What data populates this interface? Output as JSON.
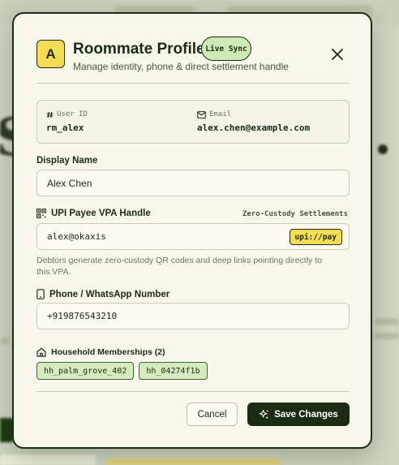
{
  "background": {
    "large_letter": "S"
  },
  "header": {
    "avatar_letter": "A",
    "title": "Roommate Profile",
    "badge": "Live Sync",
    "subtitle": "Manage identity, phone & direct settlement handle",
    "close_icon": "close-icon"
  },
  "identity": {
    "user_id_label": "User ID",
    "user_id_value": "rm_alex",
    "email_label": "Email",
    "email_value": "alex.chen@example.com"
  },
  "display_name": {
    "label": "Display Name",
    "value": "Alex Chen"
  },
  "upi": {
    "label": "UPI Payee VPA Handle",
    "tag": "Zero-Custody Settlements",
    "value": "alex@okaxis",
    "scheme": "upi://pay",
    "help": "Debtors generate zero-custody QR codes and deep links pointing directly to this VPA."
  },
  "phone": {
    "label": "Phone / WhatsApp Number",
    "value": "+919876543210"
  },
  "households": {
    "label": "Household Memberships (2)",
    "items": [
      "hh_palm_grove_402",
      "hh_04274f1b"
    ]
  },
  "actions": {
    "cancel": "Cancel",
    "save": "Save Changes"
  },
  "colors": {
    "primary": "#1c2b14",
    "accent_yellow": "#f4dc55",
    "accent_green": "#cfe9b5",
    "surface": "#f8f7ee"
  }
}
